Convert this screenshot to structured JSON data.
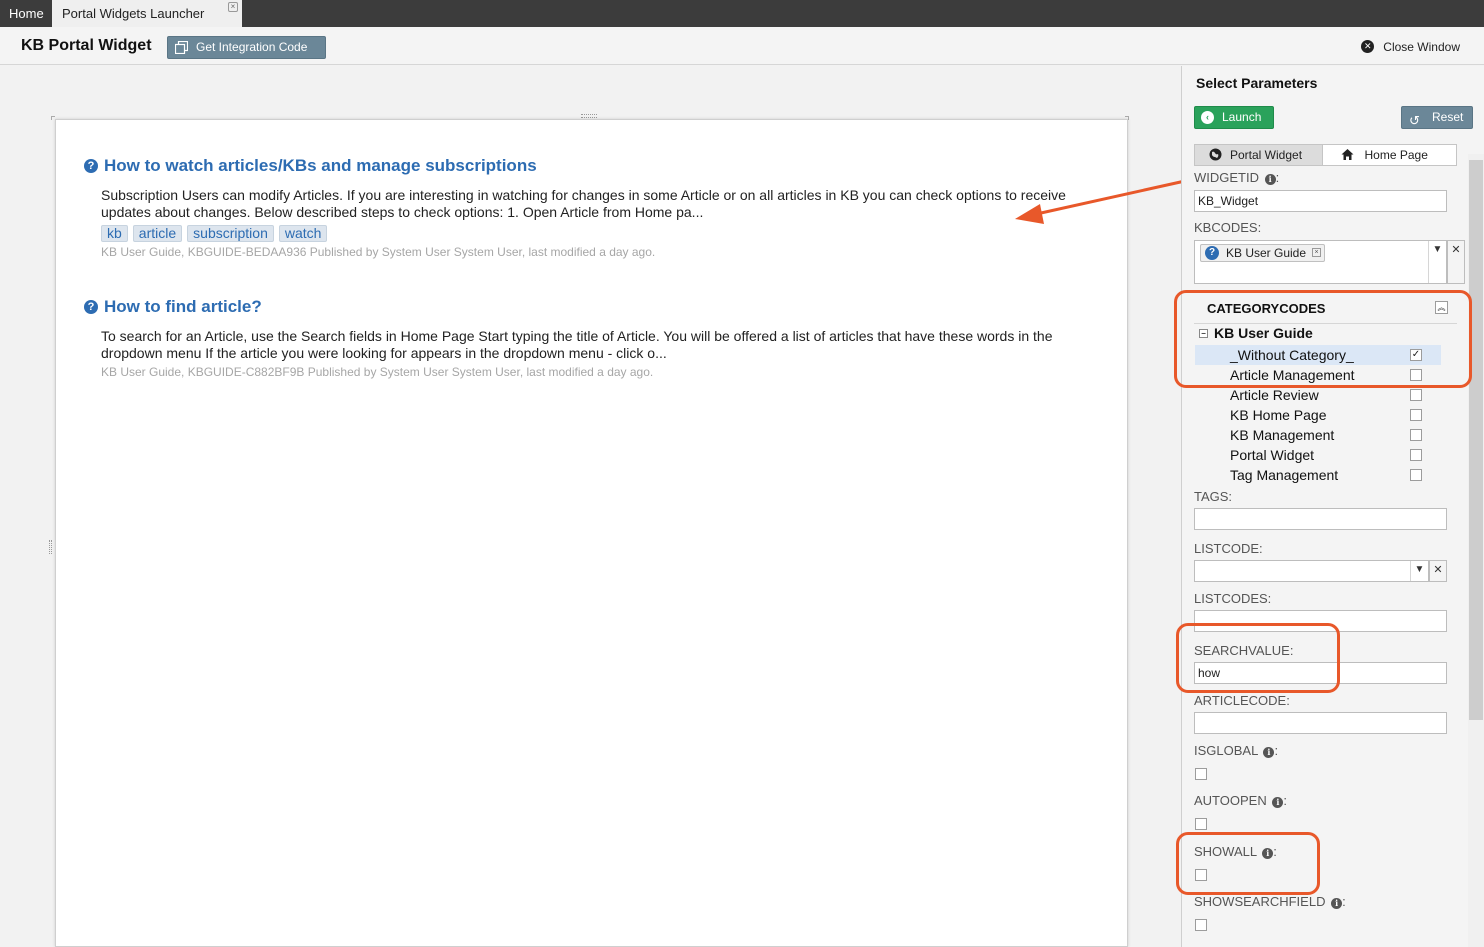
{
  "tabs": {
    "home": "Home",
    "active": "Portal Widgets Launcher",
    "close_glyph": "×"
  },
  "header": {
    "title": "KB Portal Widget",
    "integration_button": "Get Integration Code",
    "close_window": "Close Window"
  },
  "articles": [
    {
      "title": "How to watch articles/KBs and manage subscriptions",
      "body": "Subscription Users can modify Articles. If you are interesting in watching for changes in some Article or on all articles in KB you can check options to receive updates about changes. Below described steps to check options: 1. Open Article from Home pa...",
      "tags": [
        "kb",
        "article",
        "subscription",
        "watch"
      ],
      "meta": "KB User Guide, KBGUIDE-BEDAA936 Published by System User System User, last modified a day ago."
    },
    {
      "title": "How to find article?",
      "body": "To search for an Article, use the Search fields in Home Page Start typing the title of Article. You will be offered a list of articles that have these words in the dropdown menu If the article you were looking for appears in the dropdown menu - click o...",
      "tags": [],
      "meta": "KB User Guide, KBGUIDE-C882BF9B Published by System User System User, last modified a day ago."
    }
  ],
  "panel": {
    "title": "Select Parameters",
    "launch": "Launch",
    "reset": "Reset",
    "seg": {
      "portal_widget": "Portal Widget",
      "home_page": "Home Page"
    },
    "widgetid": {
      "label": "WIDGETID",
      "value": "KB_Widget"
    },
    "kbcodes": {
      "label": "KBCODES:",
      "chip": "KB User Guide"
    },
    "categorycodes": {
      "title": "CATEGORYCODES",
      "root": "KB User Guide",
      "items": [
        {
          "label": "_Without Category_",
          "checked": true
        },
        {
          "label": "Article Management",
          "checked": false
        },
        {
          "label": "Article Review",
          "checked": false
        },
        {
          "label": "KB Home Page",
          "checked": false
        },
        {
          "label": "KB Management",
          "checked": false
        },
        {
          "label": "Portal Widget",
          "checked": false
        },
        {
          "label": "Tag Management",
          "checked": false
        }
      ]
    },
    "tags": {
      "label": "TAGS:",
      "value": ""
    },
    "listcode": {
      "label": "LISTCODE:",
      "value": ""
    },
    "listcodes": {
      "label": "LISTCODES:",
      "value": ""
    },
    "searchvalue": {
      "label": "SEARCHVALUE:",
      "value": "how"
    },
    "articlecode": {
      "label": "ARTICLECODE:",
      "value": ""
    },
    "isglobal": {
      "label": "ISGLOBAL",
      "checked": false
    },
    "autoopen": {
      "label": "AUTOOPEN",
      "checked": false
    },
    "showall": {
      "label": "SHOWALL",
      "checked": false
    },
    "showsearchfield": {
      "label": "SHOWSEARCHFIELD",
      "checked": false
    }
  },
  "colors": {
    "accent_blue": "#2d6cb2",
    "launch_green": "#2aa25b",
    "highlight_orange": "#e8582a",
    "button_slate": "#6b8798"
  }
}
